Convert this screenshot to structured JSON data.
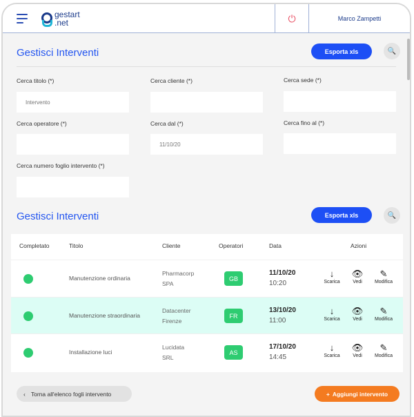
{
  "header": {
    "logo_line1": "gestart",
    "logo_line2": ".net",
    "user": "Marco Zampetti",
    "power_icon": "⏻"
  },
  "search": {
    "title": "Gestisci Interventi",
    "export": "Esporta xls",
    "fields": [
      {
        "label": "Cerca titolo (*)",
        "value": "Intervento"
      },
      {
        "label": "Cerca cliente (*)",
        "value": ""
      },
      {
        "label": "Cerca sede (*)",
        "value": ""
      },
      {
        "label": "Cerca operatore (*)",
        "value": ""
      },
      {
        "label": "Cerca dal (*)",
        "value": "11/10/20"
      },
      {
        "label": "Cerca fino al (*)",
        "value": ""
      },
      {
        "label": "Cerca numero foglio intervento (*)",
        "value": ""
      }
    ]
  },
  "list": {
    "title": "Gestisci Interventi",
    "export": "Esporta xls",
    "columns": [
      "Completato",
      "Titolo",
      "Cliente",
      "Operatori",
      "Data",
      "Azioni"
    ],
    "actions": [
      "Scarica",
      "Vedi",
      "Modifica"
    ],
    "rows": [
      {
        "title": "Manutenzione ordinaria",
        "client1": "Pharmacorp",
        "client2": "SPA",
        "op": "GB",
        "date": "11/10/20",
        "time": "10:20"
      },
      {
        "title": "Manutenzione straordinaria",
        "client1": "Datacenter",
        "client2": "Firenze",
        "op": "FR",
        "date": "13/10/20",
        "time": "11:00"
      },
      {
        "title": "Installazione luci",
        "client1": "Lucidata",
        "client2": "SRL",
        "op": "AS",
        "date": "17/10/20",
        "time": "14:45"
      }
    ]
  },
  "footer": {
    "back": "Torna all'elenco fogli intervento",
    "add": "Aggiungi intervento"
  }
}
